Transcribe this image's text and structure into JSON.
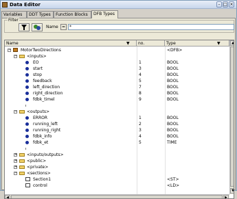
{
  "window": {
    "title": "Data Editor",
    "buttons": [
      "–",
      "□",
      "×"
    ]
  },
  "tabs": [
    "Variables",
    "DDT Types",
    "Function Blocks",
    "DFB Types"
  ],
  "active_tab_index": 3,
  "filter": {
    "group_label": "Filter",
    "filter_icon": "funnel-icon",
    "options_icon": "filter-options-icon",
    "name_label": "Name",
    "eq_label": "=",
    "name_value": "*"
  },
  "columns": {
    "name": "Name",
    "no": "no.",
    "type": "Type"
  },
  "rows": [
    {
      "name": "MotorTwoDirections",
      "no": "",
      "type": "<DFB>",
      "icon": "dfb-icon",
      "expander": "−"
    },
    {
      "name": "<inputs>",
      "no": "",
      "type": "",
      "icon": "folder-icon",
      "expander": "−"
    },
    {
      "name": "EO",
      "no": "1",
      "type": "BOOL",
      "icon": "variable-icon",
      "expander": ""
    },
    {
      "name": "start",
      "no": "3",
      "type": "BOOL",
      "icon": "variable-icon",
      "expander": ""
    },
    {
      "name": "stop",
      "no": "4",
      "type": "BOOL",
      "icon": "variable-icon",
      "expander": ""
    },
    {
      "name": "feedback",
      "no": "5",
      "type": "BOOL",
      "icon": "variable-icon",
      "expander": ""
    },
    {
      "name": "left_direction",
      "no": "7",
      "type": "BOOL",
      "icon": "variable-icon",
      "expander": ""
    },
    {
      "name": "right_direction",
      "no": "8",
      "type": "BOOL",
      "icon": "variable-icon",
      "expander": ""
    },
    {
      "name": "fdbk_timel",
      "no": "9",
      "type": "BOOL",
      "icon": "variable-icon",
      "expander": ""
    },
    {
      "name": "",
      "no": "",
      "type": "",
      "icon": "new-entry-icon",
      "expander": ""
    },
    {
      "name": "<outputs>",
      "no": "",
      "type": "",
      "icon": "folder-icon",
      "expander": "−"
    },
    {
      "name": "ERROR",
      "no": "1",
      "type": "BOOL",
      "icon": "variable-icon",
      "expander": ""
    },
    {
      "name": "running_left",
      "no": "2",
      "type": "BOOL",
      "icon": "variable-icon",
      "expander": ""
    },
    {
      "name": "running_right",
      "no": "3",
      "type": "BOOL",
      "icon": "variable-icon",
      "expander": ""
    },
    {
      "name": "fdbk_info",
      "no": "4",
      "type": "BOOL",
      "icon": "variable-icon",
      "expander": ""
    },
    {
      "name": "fdbk_et",
      "no": "5",
      "type": "TIME",
      "icon": "variable-icon",
      "expander": ""
    },
    {
      "name": "",
      "no": "",
      "type": "",
      "icon": "new-entry-icon",
      "expander": ""
    },
    {
      "name": "<inputs/outputs>",
      "no": "",
      "type": "",
      "icon": "folder-icon",
      "expander": "+"
    },
    {
      "name": "<public>",
      "no": "",
      "type": "",
      "icon": "folder-icon",
      "expander": "+"
    },
    {
      "name": "<private>",
      "no": "",
      "type": "",
      "icon": "folder-icon",
      "expander": "+"
    },
    {
      "name": "<sections>",
      "no": "",
      "type": "",
      "icon": "folder-icon",
      "expander": "−"
    },
    {
      "name": "Section1",
      "no": "",
      "type": "<ST>",
      "icon": "section-icon",
      "expander": ""
    },
    {
      "name": "control",
      "no": "",
      "type": "<LD>",
      "icon": "section-icon",
      "expander": ""
    }
  ]
}
